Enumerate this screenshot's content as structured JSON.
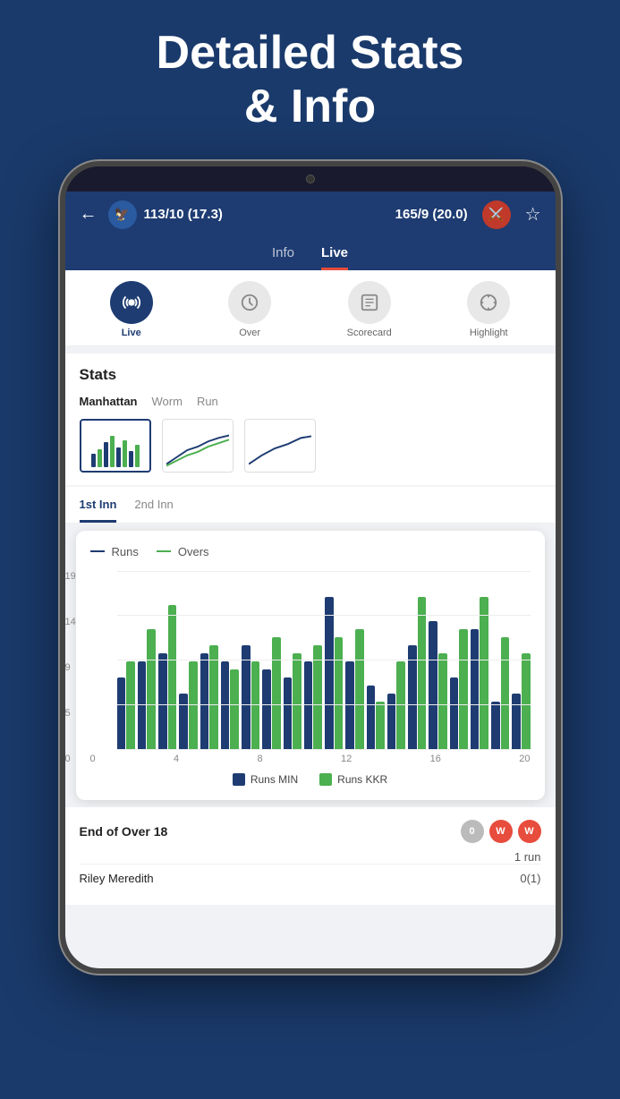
{
  "header": {
    "title_line1": "Detailed Stats",
    "title_line2": "& Info"
  },
  "score_bar": {
    "back_label": "←",
    "team1_logo": "🦅",
    "team1_score": "113/10 (17.3)",
    "team2_score": "165/9 (20.0)",
    "team2_logo": "⚔️",
    "star": "☆"
  },
  "tabs": {
    "items": [
      {
        "label": "Info",
        "active": false
      },
      {
        "label": "Live",
        "active": true
      }
    ]
  },
  "icon_tabs": [
    {
      "label": "Live",
      "icon": "📡",
      "active": true
    },
    {
      "label": "Over",
      "icon": "🔄",
      "active": false
    },
    {
      "label": "Scorecard",
      "icon": "📋",
      "active": false
    },
    {
      "label": "Highlight",
      "icon": "🎬",
      "active": false
    }
  ],
  "stats": {
    "title": "Stats",
    "chart_types": [
      {
        "label": "Manhattan",
        "active": true
      },
      {
        "label": "Worm",
        "active": false
      },
      {
        "label": "Run",
        "active": false
      }
    ]
  },
  "inn_tabs": [
    {
      "label": "1st Inn",
      "active": true
    },
    {
      "label": "2nd Inn",
      "active": false
    }
  ],
  "legend": {
    "runs_label": "Runs",
    "overs_label": "Overs"
  },
  "y_axis_labels": [
    "19",
    "14",
    "9",
    "5",
    "0"
  ],
  "x_axis_labels": [
    "0",
    "4",
    "8",
    "12",
    "16",
    "20"
  ],
  "bar_data": [
    {
      "blue": 45,
      "green": 55
    },
    {
      "blue": 55,
      "green": 75
    },
    {
      "blue": 60,
      "green": 90
    },
    {
      "blue": 35,
      "green": 55
    },
    {
      "blue": 60,
      "green": 65
    },
    {
      "blue": 55,
      "green": 50
    },
    {
      "blue": 65,
      "green": 55
    },
    {
      "blue": 50,
      "green": 70
    },
    {
      "blue": 45,
      "green": 60
    },
    {
      "blue": 55,
      "green": 65
    },
    {
      "blue": 95,
      "green": 70
    },
    {
      "blue": 55,
      "green": 75
    },
    {
      "blue": 40,
      "green": 30
    },
    {
      "blue": 35,
      "green": 55
    },
    {
      "blue": 65,
      "green": 95
    },
    {
      "blue": 80,
      "green": 60
    },
    {
      "blue": 45,
      "green": 75
    },
    {
      "blue": 75,
      "green": 95
    },
    {
      "blue": 30,
      "green": 70
    },
    {
      "blue": 35,
      "green": 60
    }
  ],
  "chart_legend_bottom": {
    "runs_min_label": "Runs MIN",
    "runs_kkr_label": "Runs KKR"
  },
  "over_card": {
    "title": "End of Over 18",
    "runs_text": "1 run",
    "badges": [
      "0",
      "W",
      "W"
    ],
    "badge_colors": [
      "gray",
      "red",
      "red"
    ],
    "player_name": "Riley Meredith",
    "player_score": "0(1)"
  }
}
